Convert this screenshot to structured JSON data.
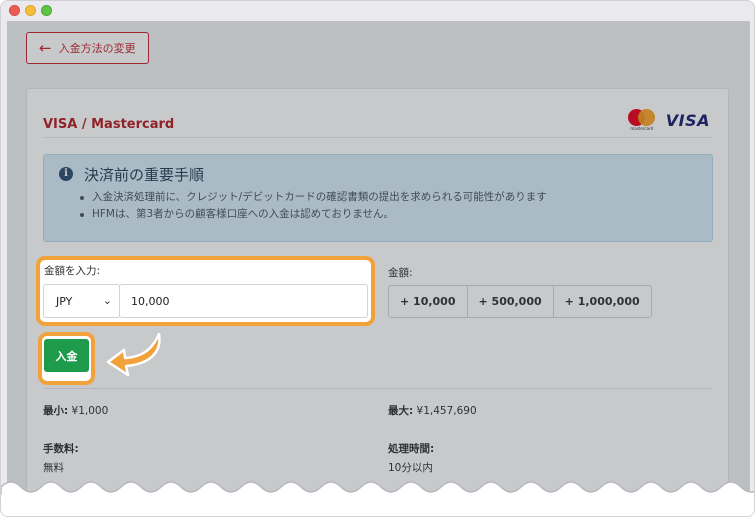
{
  "back_button": {
    "label": "入金方法の変更"
  },
  "card": {
    "title": "VISA / Mastercard",
    "brands": {
      "mastercard_text": "mastercard",
      "visa_text": "VISA"
    }
  },
  "notice": {
    "title": "決済前の重要手順",
    "items": [
      "入金決済処理前に、クレジット/デビットカードの確認書類の提出を求められる可能性があります",
      "HFMは、第3者からの顧客様口座への入金は認めておりません。"
    ]
  },
  "amount": {
    "label": "金額を入力:",
    "currency": "JPY",
    "value": "10,000"
  },
  "quick": {
    "label": "金額:",
    "buttons": [
      "+ 10,000",
      "+ 500,000",
      "+ 1,000,000"
    ]
  },
  "deposit_button": {
    "label": "入金"
  },
  "limits": {
    "min_label": "最小:",
    "min_value": "¥1,000",
    "max_label": "最大:",
    "max_value": "¥1,457,690",
    "fee_label": "手数料:",
    "fee_value": "無料",
    "time_label": "処理時間:",
    "time_value": "10分以内"
  },
  "colors": {
    "accent": "#c62a2f",
    "highlight": "#f2a23a",
    "deposit": "#1e9b4b",
    "notice_bg": "#d9edf7"
  }
}
